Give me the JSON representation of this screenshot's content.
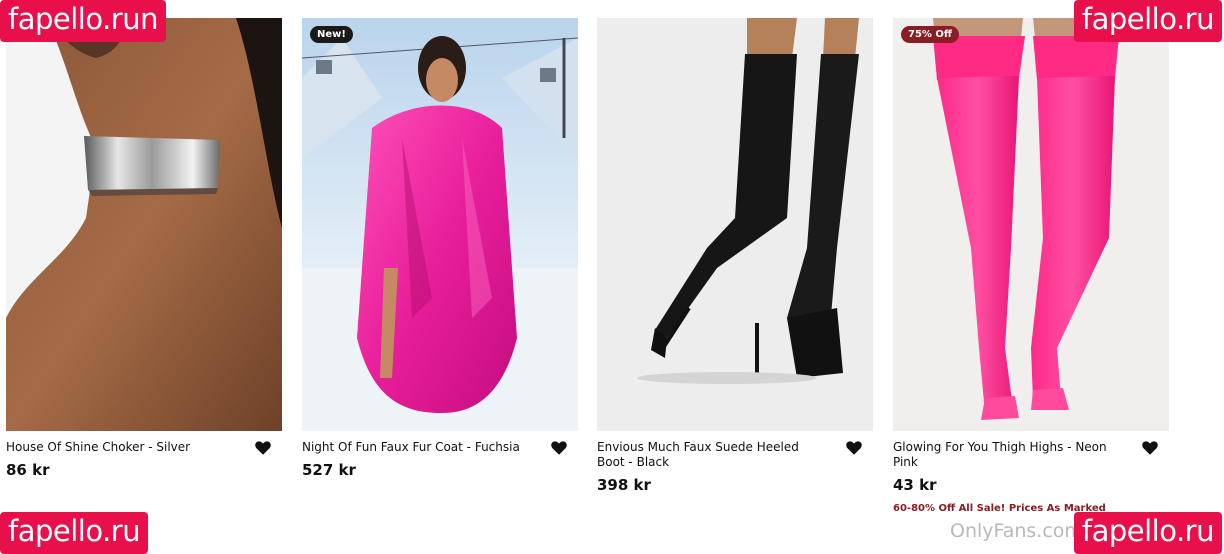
{
  "products": [
    {
      "name": "House Of Shine Choker - Silver",
      "price": "86 kr",
      "badge": "",
      "promo": "",
      "image": "silver-choker-photo"
    },
    {
      "name": "Night Of Fun Faux Fur Coat - Fuchsia",
      "price": "527 kr",
      "badge": "New!",
      "promo": "",
      "image": "fuchsia-fur-coat-photo"
    },
    {
      "name": "Envious Much Faux Suede Heeled Boot - Black",
      "price": "398 kr",
      "badge": "",
      "promo": "",
      "image": "black-thigh-boot-photo"
    },
    {
      "name": "Glowing For You Thigh Highs - Neon Pink",
      "price": "43 kr",
      "badge": "75% Off",
      "promo": "60-80% Off All Sale! Prices As Marked",
      "image": "neon-pink-thigh-highs-photo"
    }
  ],
  "watermarks": {
    "top_left": "fapello.run",
    "top_right": "fapello.ru",
    "bottom_left": "fapello.ru",
    "bottom_right": "fapello.ru",
    "credit": "OnlyFans.com"
  },
  "colors": {
    "sale_red": "#8b1c24",
    "watermark_pink": "#e8104a"
  },
  "icons": {
    "wishlist": "heart-icon"
  }
}
